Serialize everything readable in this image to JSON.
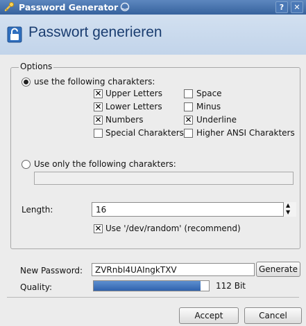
{
  "window": {
    "title": "Password Generator",
    "help_glyph": "?",
    "close_glyph": "✕"
  },
  "header": {
    "title": "Passwort generieren"
  },
  "options": {
    "group_label": "Options",
    "mode_following": "use the following charakters:",
    "mode_only": "Use only the following charakters:",
    "only_value": "",
    "checkboxes": [
      {
        "label": "Upper Letters",
        "checked": true
      },
      {
        "label": "Lower Letters",
        "checked": true
      },
      {
        "label": "Numbers",
        "checked": true
      },
      {
        "label": "Special Charakters",
        "checked": false
      },
      {
        "label": "Space",
        "checked": false
      },
      {
        "label": "Minus",
        "checked": false
      },
      {
        "label": "Underline",
        "checked": true
      },
      {
        "label": "Higher ANSI Charakters",
        "checked": false
      }
    ],
    "length_label": "Length:",
    "length_value": "16",
    "devrandom_label": "Use '/dev/random' (recommend)",
    "devrandom_checked": true
  },
  "result": {
    "password_label": "New Password:",
    "password_value": "ZVRnbI4UAIngkTXV",
    "generate_label": "Generate",
    "quality_label": "Quality:",
    "quality_fraction": 0.93,
    "quality_text": "112 Bit"
  },
  "footer": {
    "accept_label": "Accept",
    "cancel_label": "Cancel"
  },
  "colors": {
    "titlebar": "#36629d",
    "header_bg": "#c2d4ea",
    "accent": "#2f62ad"
  }
}
